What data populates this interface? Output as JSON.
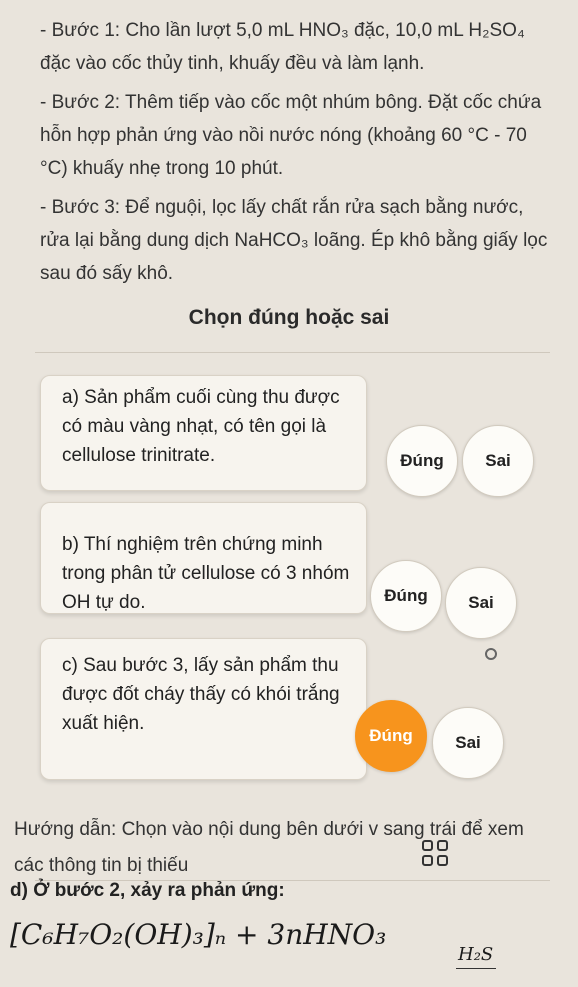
{
  "steps": [
    "- Bước 1: Cho lần lượt 5,0 mL HNO₃ đặc, 10,0 mL H₂SO₄ đặc vào cốc thủy tinh, khuấy đều và làm lạnh.",
    "- Bước 2: Thêm tiếp vào cốc một nhúm bông. Đặt cốc chứa hỗn hợp phản ứng vào nồi nước nóng (khoảng 60 °C - 70 °C) khuấy nhẹ trong 10 phút.",
    "- Bước 3: Để nguội, lọc lấy chất rắn rửa sạch bằng nước, rửa lại bằng dung dịch NaHCO₃ loãng. Ép khô bằng giấy lọc sau đó sấy khô."
  ],
  "section_title": "Chọn đúng hoặc sai",
  "questions": [
    {
      "text": "a) Sản phẩm cuối cùng thu được có màu vàng nhạt, có tên gọi là cellulose trinitrate.",
      "true_label": "Đúng",
      "false_label": "Sai",
      "selected": "none"
    },
    {
      "text": "b) Thí nghiệm trên chứng minh trong phân tử cellulose có 3 nhóm OH tự do.",
      "true_label": "Đúng",
      "false_label": "Sai",
      "selected": "none"
    },
    {
      "text": "c) Sau bước 3, lấy sản phẩm thu được đốt cháy thấy có khói trắng xuất hiện.",
      "true_label": "Đúng",
      "false_label": "Sai",
      "selected": "true"
    }
  ],
  "hint": "Hướng dẫn: Chọn vào nội dung bên dưới v sang trái để xem các thông tin bị thiếu",
  "part_d": "d) Ở bước 2, xảy ra phản ứng:",
  "formula": "[C₆H₇O₂(OH)₃]ₙ + 3nHNO₃",
  "formula_condition": "H₂S",
  "colors": {
    "selected": "#f7941d",
    "background": "#e9e4dc"
  },
  "icons": [
    "grid-icon"
  ]
}
